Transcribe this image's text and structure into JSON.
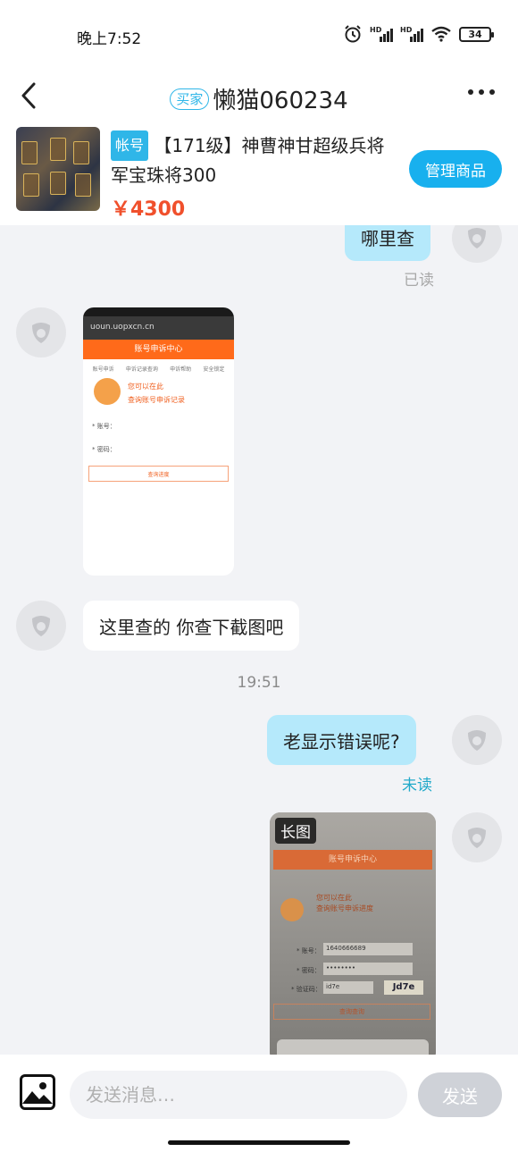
{
  "status_bar": {
    "time": "晚上7:52",
    "battery": "34",
    "hd1": "HD",
    "hd2": "HD"
  },
  "header": {
    "buyer_tag": "买家",
    "title": "懒猫060234"
  },
  "product": {
    "tag": "帐号",
    "title": "【171级】神曹神甘超级兵将军宝珠将300",
    "price": "￥4300",
    "manage_button": "管理商品"
  },
  "messages": {
    "m1_text": "哪里查",
    "m1_status": "已读",
    "m2_img_url": "uoun.uopxcn.cn",
    "m2_img_banner": "账号申诉中心",
    "m2_img_tabs": [
      "账号申诉",
      "申诉记录查询",
      "申诉帮助",
      "安全锁定"
    ],
    "m2_img_notice1": "您可以在此",
    "m2_img_notice2": "查询账号申诉记录",
    "m2_img_field1": "* 账号：",
    "m2_img_field2": "* 密码：",
    "m2_img_button": "查询进度",
    "m3_text": "这里查的 你查下截图吧",
    "timestamp": "19:51",
    "m4_text": "老显示错误呢?",
    "m4_status": "未读",
    "m5_long_tag": "长图",
    "m5_img_banner": "账号申诉中心",
    "m5_img_notice1": "您可以在此",
    "m5_img_notice2": "查询账号申诉进度",
    "m5_img_field1": "* 账号：",
    "m5_img_field1_value": "1640666689",
    "m5_img_field2": "* 密码：",
    "m5_img_field2_value": "••••••••",
    "m5_img_field3": "* 验证码：",
    "m5_img_field3_value": "id7e",
    "m5_img_captcha": "Jd7e",
    "m5_img_button": "查询查询"
  },
  "composer": {
    "placeholder": "发送消息…",
    "send_label": "发送"
  },
  "colors": {
    "accent": "#18b0ee",
    "price": "#f0502c",
    "mine_bubble": "#b5e9fb",
    "unread": "#21a9c9"
  }
}
